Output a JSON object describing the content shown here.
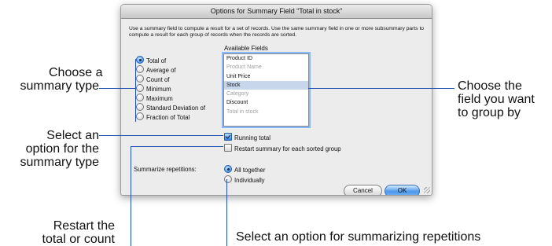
{
  "dialog": {
    "title": "Options for Summary Field “Total in stock”",
    "description": "Use a summary field to compute a result for a set of records. Use the same summary field in one or more subsummary parts to compute a result for each group of records when the records are sorted.",
    "summary_types": [
      {
        "label": "Total of",
        "selected": true
      },
      {
        "label": "Average of",
        "selected": false
      },
      {
        "label": "Count of",
        "selected": false
      },
      {
        "label": "Minimum",
        "selected": false
      },
      {
        "label": "Maximum",
        "selected": false
      },
      {
        "label": "Standard Deviation of",
        "selected": false
      },
      {
        "label": "Fraction of Total",
        "selected": false
      }
    ],
    "available_fields_label": "Available Fields",
    "fields": [
      {
        "label": "Product ID",
        "state": "normal"
      },
      {
        "label": "Product Name",
        "state": "disabled"
      },
      {
        "label": "Unit Price",
        "state": "normal"
      },
      {
        "label": "Stock",
        "state": "selected"
      },
      {
        "label": "Category",
        "state": "disabled"
      },
      {
        "label": "Discount",
        "state": "normal"
      },
      {
        "label": "Total in stock",
        "state": "disabled"
      }
    ],
    "running_total_label": "Running total",
    "running_total_checked": true,
    "restart_label": "Restart summary for each sorted group",
    "restart_checked": false,
    "summarize_repetitions_label": "Summarize repetitions:",
    "repetition_options": [
      {
        "label": "All together",
        "selected": true
      },
      {
        "label": "Individually",
        "selected": false
      }
    ],
    "cancel_label": "Cancel",
    "ok_label": "OK"
  },
  "callouts": {
    "summary_type": [
      "Choose a",
      "summary type"
    ],
    "field": [
      "Choose the",
      "field you want",
      "to group by"
    ],
    "option": [
      "Select an",
      "option for the",
      "summary type"
    ],
    "restart": [
      "Restart the",
      "total or count"
    ],
    "repetitions": "Select an option for summarizing repetitions"
  },
  "colors": {
    "callout_line": "#1f4fb0",
    "selection": "#c8d6ec",
    "default_button": "#4b97ea"
  }
}
